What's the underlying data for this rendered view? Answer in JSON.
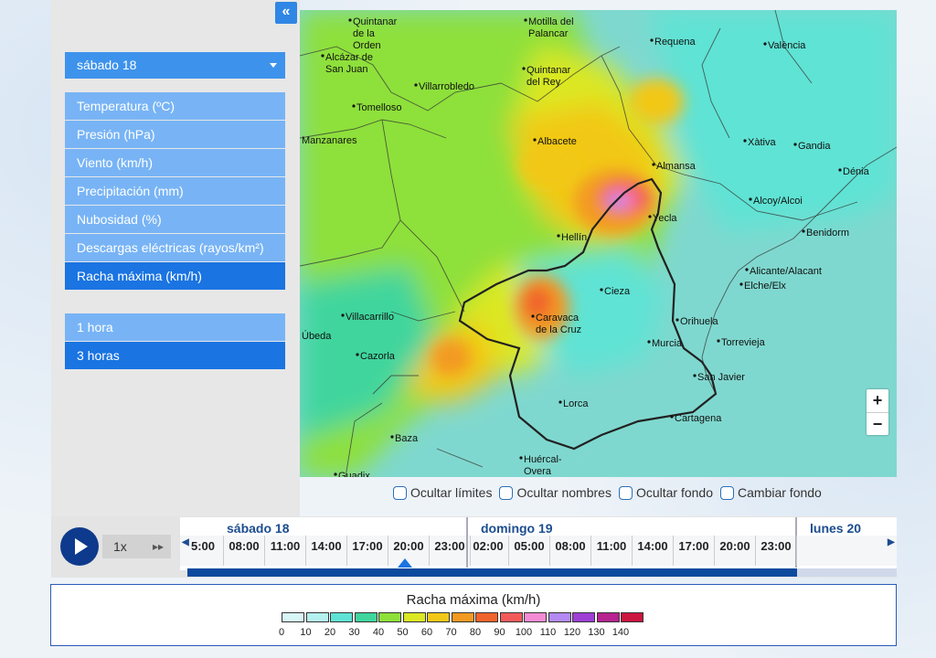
{
  "sidebar": {
    "collapse_label": "«",
    "day_select": "sábado 18",
    "variables": [
      {
        "label": "Temperatura (ºC)",
        "active": false
      },
      {
        "label": "Presión (hPa)",
        "active": false
      },
      {
        "label": "Viento (km/h)",
        "active": false
      },
      {
        "label": "Precipitación (mm)",
        "active": false
      },
      {
        "label": "Nubosidad (%)",
        "active": false
      },
      {
        "label": "Descargas eléctricas (rayos/km²)",
        "active": false
      },
      {
        "label": "Racha máxima (km/h)",
        "active": true
      }
    ],
    "intervals": [
      {
        "label": "1 hora",
        "active": false
      },
      {
        "label": "3 horas",
        "active": true
      }
    ]
  },
  "map": {
    "cities": [
      "Quintanar de la Orden",
      "Motilla del Palancar",
      "Requena",
      "València",
      "Alcázar de San Juan",
      "Villarrobledo",
      "Quintanar del Rey",
      "Tomelloso",
      "Manzanares",
      "Albacete",
      "Xàtiva",
      "Gandia",
      "Almansa",
      "Dénia",
      "Alcoy/Alcoi",
      "Yecla",
      "Benidorm",
      "Hellín",
      "Alicante/Alacant",
      "Cieza",
      "Elche/Elx",
      "Villacarrillo",
      "Caravaca de la Cruz",
      "Orihuela",
      "Úbeda",
      "Murcia",
      "Torrevieja",
      "Cazorla",
      "San Javier",
      "Lorca",
      "Cartagena",
      "Baza",
      "Huércal-Overa",
      "Guadix"
    ],
    "zoom_in": "+",
    "zoom_out": "−",
    "logo": "aemet"
  },
  "options": {
    "hide_limits": "Ocultar límites",
    "hide_names": "Ocultar nombres",
    "hide_background": "Ocultar fondo",
    "change_background": "Cambiar fondo"
  },
  "player": {
    "speed": "1x",
    "ff": "▸▸",
    "days": [
      "sábado 18",
      "domingo 19",
      "lunes 20"
    ],
    "hours_sat": [
      "5:00",
      "08:00",
      "11:00",
      "14:00",
      "17:00",
      "20:00",
      "23:00"
    ],
    "hours_sun": [
      "02:00",
      "05:00",
      "08:00",
      "11:00",
      "14:00",
      "17:00",
      "20:00",
      "23:00"
    ],
    "selected_hour": "20:00",
    "progress": 0.86
  },
  "legend": {
    "title": "Racha máxima (km/h)",
    "ticks": [
      "0",
      "10",
      "20",
      "30",
      "40",
      "50",
      "60",
      "70",
      "80",
      "90",
      "100",
      "110",
      "120",
      "130",
      "140"
    ],
    "colors": [
      "#d9f6f6",
      "#b4f1ef",
      "#5fe3d4",
      "#3fd59d",
      "#8ee03a",
      "#dbe824",
      "#f2c818",
      "#f39a22",
      "#f0632c",
      "#f25a5a",
      "#f58bd4",
      "#b38af1",
      "#9e3fd6",
      "#b7238f",
      "#cc1440"
    ]
  }
}
